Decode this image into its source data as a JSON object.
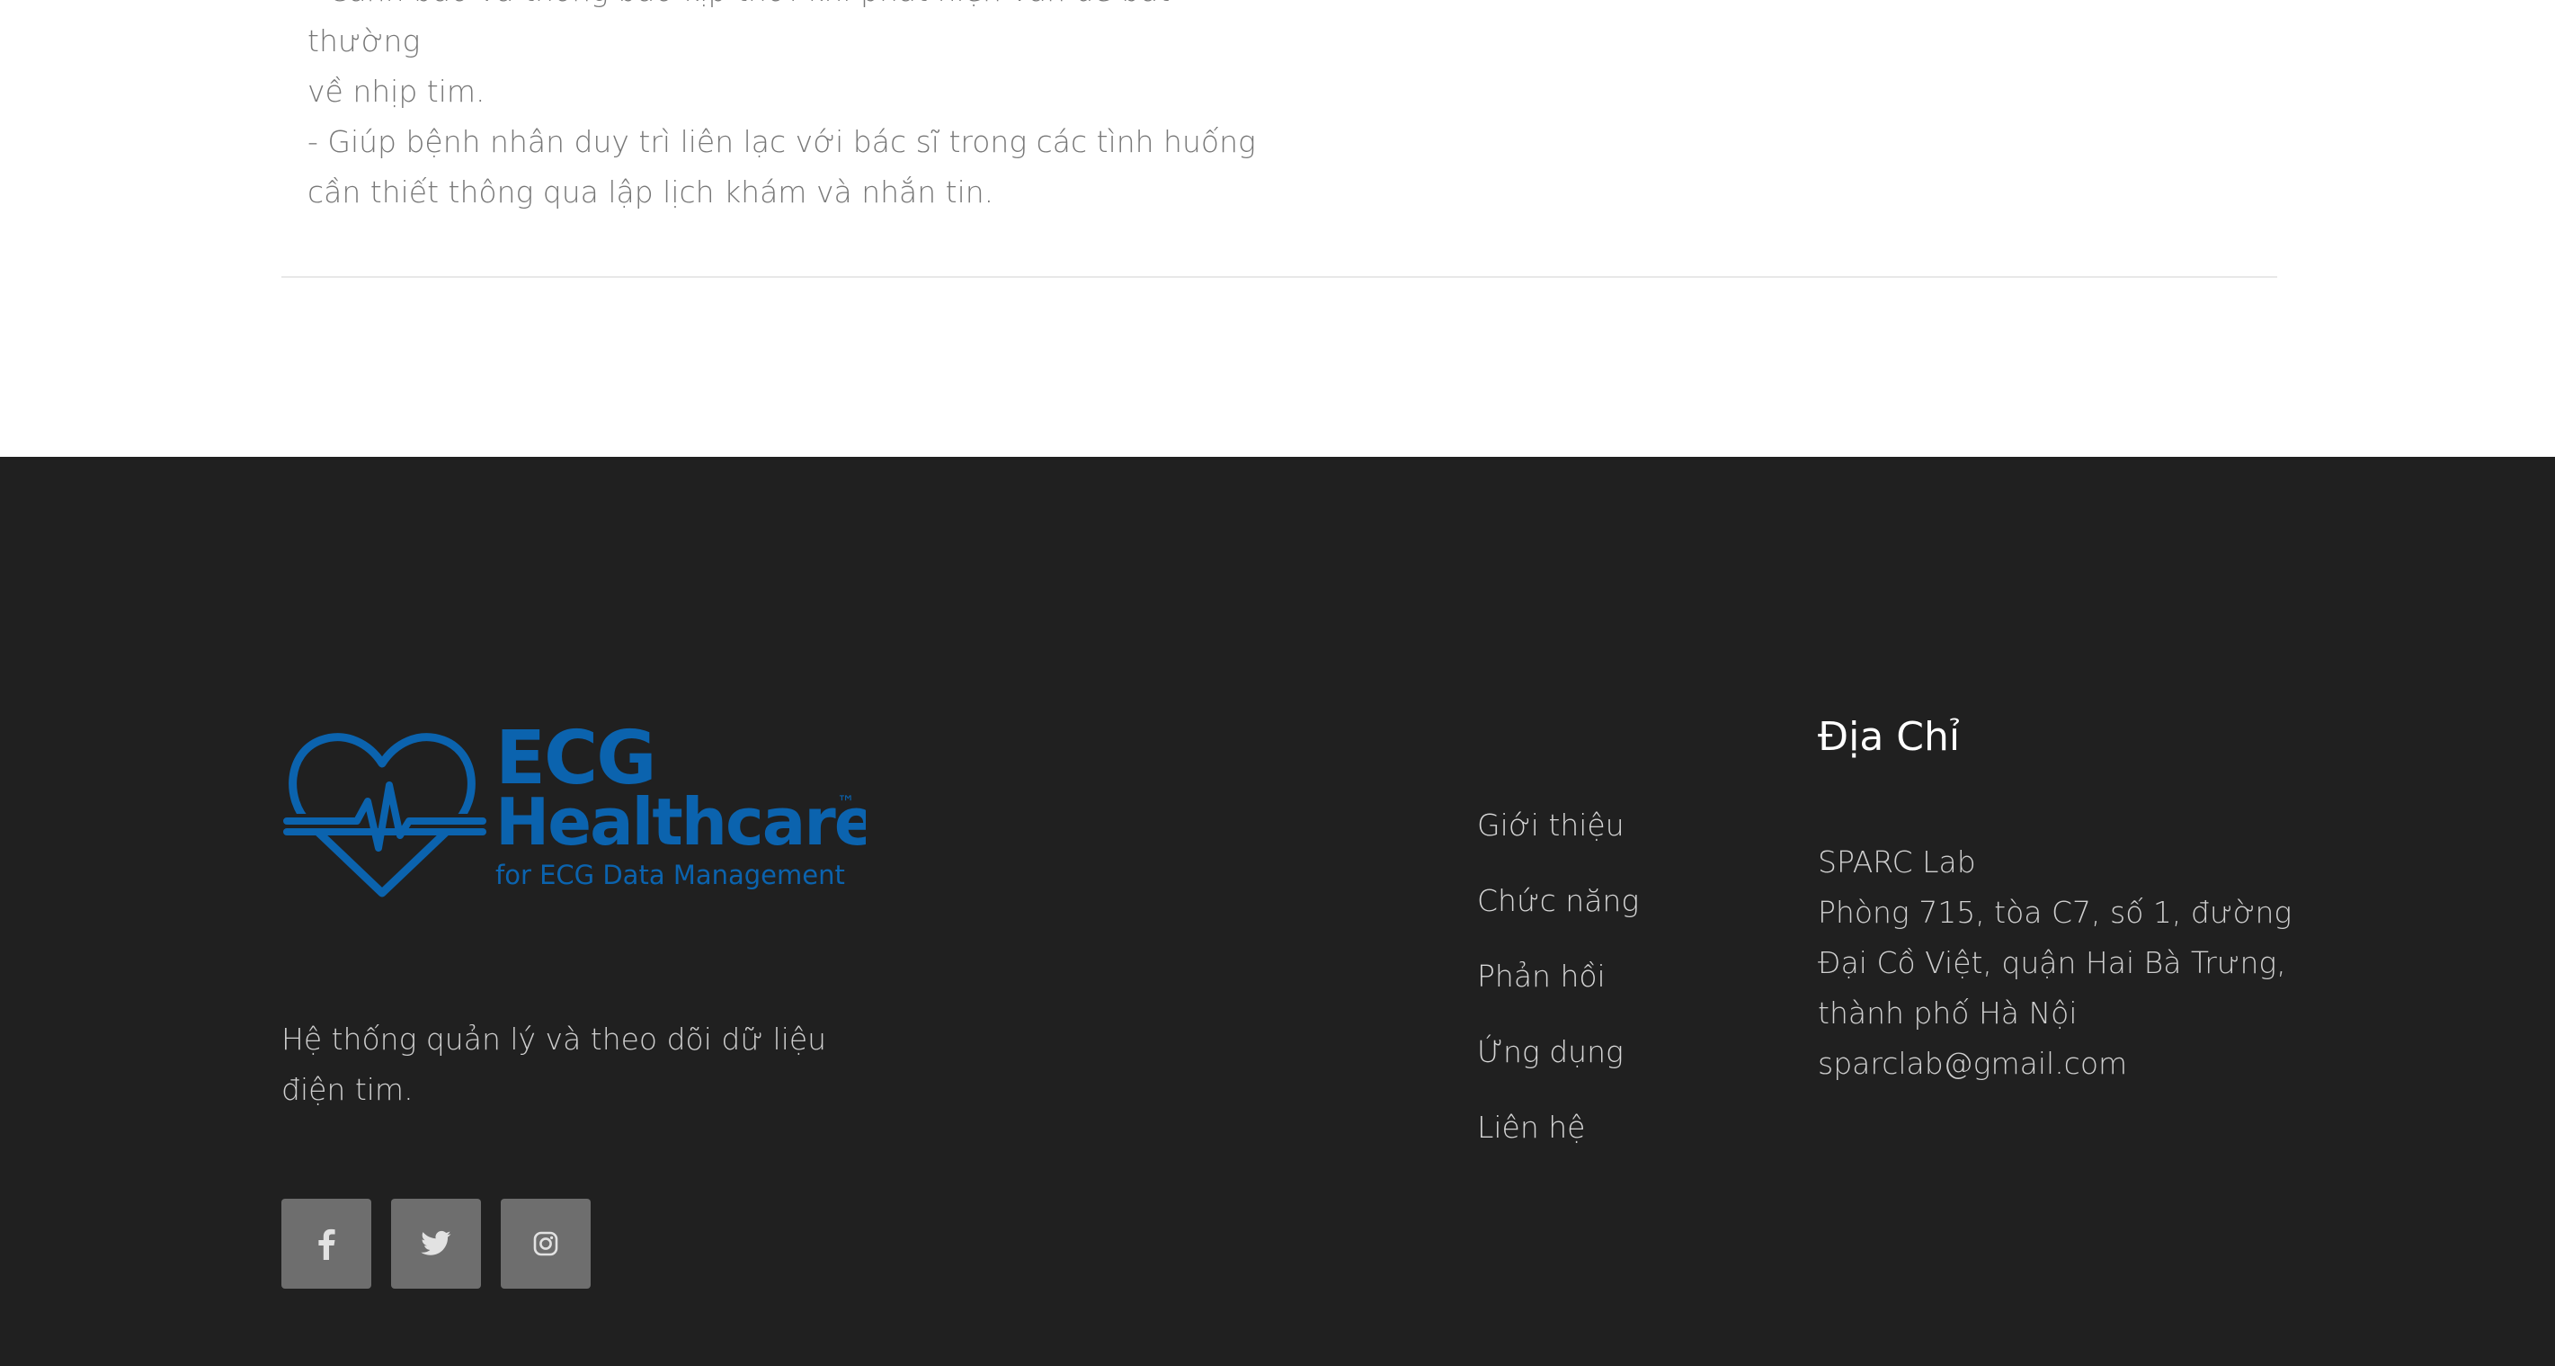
{
  "features": {
    "line_1": "- Cảnh báo và thông báo kịp thời khi phát hiện vấn đề bất thường",
    "line_2": "về nhịp tim.",
    "line_3": "- Giúp bệnh nhân duy trì liên lạc với bác sĩ trong các tình huống",
    "line_4": "cần thiết thông qua lập lịch khám và nhắn tin."
  },
  "footer": {
    "logo": {
      "title_line_1": "ECG",
      "title_line_2": "Healthcare",
      "trademark": "™",
      "subtitle": "for ECG Data Management",
      "color": "#0b63ae"
    },
    "tagline": "Hệ thống quản lý và theo dõi dữ liệu điện tim.",
    "socials": [
      {
        "name": "facebook",
        "icon": "facebook-icon"
      },
      {
        "name": "twitter",
        "icon": "twitter-icon"
      },
      {
        "name": "instagram",
        "icon": "instagram-icon"
      }
    ],
    "nav": {
      "about": "Giới thiệu",
      "features": "Chức năng",
      "feedback": "Phản hồi",
      "app": "Ứng dụng",
      "contact": "Liên hệ"
    },
    "address": {
      "title": "Địa Chỉ",
      "org": "SPARC Lab",
      "line_1": "Phòng 715, tòa C7, số 1, đường",
      "line_2": "Đại Cồ Việt, quận Hai Bà Trưng,",
      "line_3": "thành phố Hà Nội",
      "email": "sparclab@gmail.com"
    }
  },
  "colors": {
    "footer_bg": "#202020",
    "social_bg": "#6e6e6e",
    "brand_blue": "#0b63ae"
  }
}
